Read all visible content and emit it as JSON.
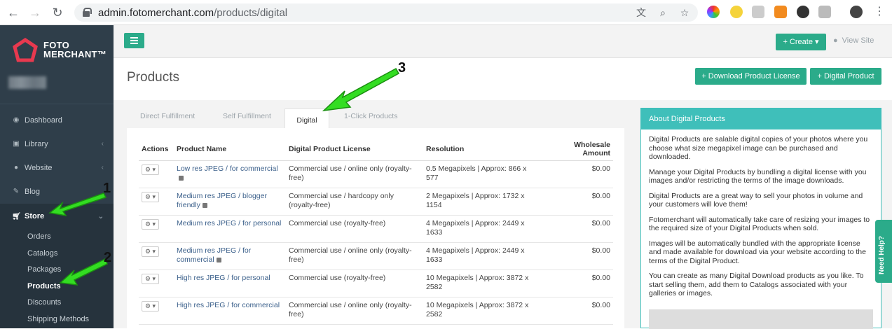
{
  "browser": {
    "url_host": "admin.fotomerchant.com",
    "url_path": "/products/digital"
  },
  "sidebar": {
    "logo_line1": "FOTO",
    "logo_line2": "MERCHANT™",
    "items": [
      {
        "label": "Dashboard",
        "icon": "dashboard-icon"
      },
      {
        "label": "Library",
        "icon": "image-icon"
      },
      {
        "label": "Website",
        "icon": "globe-icon"
      },
      {
        "label": "Blog",
        "icon": "edit-icon"
      },
      {
        "label": "Store",
        "icon": "cart-icon"
      }
    ],
    "store_sub": [
      "Orders",
      "Catalogs",
      "Packages",
      "Products",
      "Discounts",
      "Shipping Methods"
    ]
  },
  "topbar": {
    "create_label": "+ Create ▾",
    "view_site_label": "View Site"
  },
  "header": {
    "title": "Products",
    "download_license_label": "+ Download Product License",
    "digital_product_label": "+ Digital Product"
  },
  "tabs": [
    "Direct Fulfillment",
    "Self Fulfillment",
    "Digital",
    "1-Click Products"
  ],
  "table": {
    "headers": [
      "Actions",
      "Product Name",
      "Digital Product License",
      "Resolution",
      "Wholesale Amount"
    ],
    "rows": [
      {
        "name": "Low res JPEG / for commercial",
        "license": "Commercial use / online only (royalty-free)",
        "resolution": "0.5 Megapixels | Approx: 866 x 577",
        "amount": "$0.00"
      },
      {
        "name": "Medium res JPEG / blogger friendly",
        "license": "Commercial use / hardcopy only (royalty-free)",
        "resolution": "2 Megapixels | Approx: 1732 x 1154",
        "amount": "$0.00"
      },
      {
        "name": "Medium res JPEG / for personal",
        "license": "Commercial use (royalty-free)",
        "resolution": "4 Megapixels | Approx: 2449 x 1633",
        "amount": "$0.00"
      },
      {
        "name": "Medium res JPEG / for commercial",
        "license": "Commercial use / online only (royalty-free)",
        "resolution": "4 Megapixels | Approx: 2449 x 1633",
        "amount": "$0.00"
      },
      {
        "name": "High res JPEG / for personal",
        "license": "Commercial use (royalty-free)",
        "resolution": "10 Megapixels | Approx: 3872 x 2582",
        "amount": "$0.00"
      },
      {
        "name": "High res JPEG / for commercial",
        "license": "Commercial use / online only (royalty-free)",
        "resolution": "10 Megapixels | Approx: 3872 x 2582",
        "amount": "$0.00"
      }
    ]
  },
  "about": {
    "title": "About Digital Products",
    "paragraphs": [
      "Digital Products are salable digital copies of your photos where you choose what size megapixel image can be purchased and downloaded.",
      "Manage your Digital Products by bundling a digital license with you images and/or restricting the terms of the image downloads.",
      "Digital Products are a great way to sell your photos in volume and your customers will love them!",
      "Fotomerchant will automatically take care of resizing your images to the required size of your Digital Products when sold.",
      "Images will be automatically bundled with the appropriate license and made available for download via your website according to the terms of the Digital Product.",
      "You can create as many Digital Download products as you like. To start selling them, add them to Catalogs associated with your galleries or images."
    ]
  },
  "need_help_label": "Need Help?",
  "annotations": [
    "1",
    "2",
    "3"
  ],
  "colors": {
    "accent": "#2bab8a",
    "sidebar": "#2f3e4a",
    "annotation": "#33dd22",
    "about_header": "#3fbfba"
  }
}
